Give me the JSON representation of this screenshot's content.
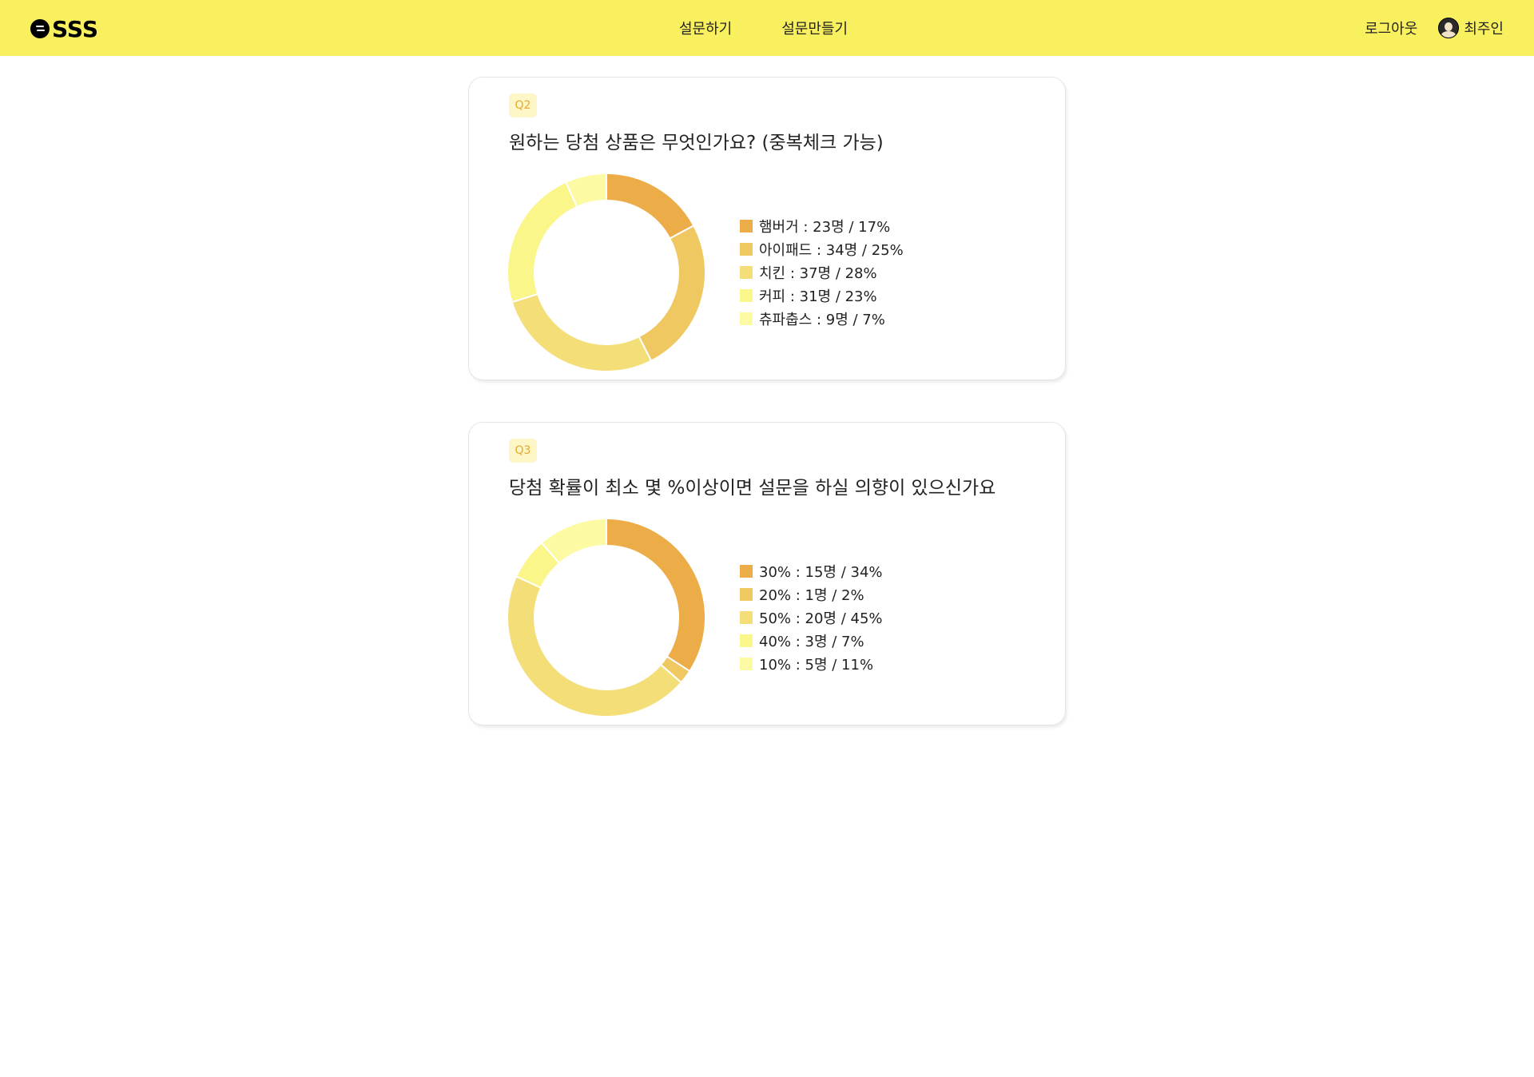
{
  "brand": {
    "name": "SSS"
  },
  "nav": {
    "items": [
      "설문하기",
      "설문만들기"
    ]
  },
  "user": {
    "logout_label": "로그아웃",
    "name": "최주인"
  },
  "colors": {
    "topbar": "#f8f05f",
    "badge_bg": "#fdf6c6",
    "badge_text": "#e6a830",
    "slices": [
      "#ecac48",
      "#f0c862",
      "#f4de78",
      "#faf68a",
      "#fdfaa4"
    ]
  },
  "questions": [
    {
      "badge": "Q2",
      "title": "원하는 당첨 상품은 무엇인가요? (중복체크 가능)",
      "legend": [
        "햄버거 : 23명 / 17%",
        "아이패드 : 34명 / 25%",
        "치킨 : 37명 / 28%",
        "커피 : 31명 / 23%",
        "츄파춥스 : 9명 / 7%"
      ]
    },
    {
      "badge": "Q3",
      "title": "당첨 확률이 최소 몇 %이상이면 설문을 하실 의향이 있으신가요",
      "legend": [
        "30% : 15명 / 34%",
        "20% : 1명 / 2%",
        "50% : 20명 / 45%",
        "40% : 3명 / 7%",
        "10% : 5명 / 11%"
      ]
    }
  ],
  "chart_data": [
    {
      "type": "pie",
      "title": "원하는 당첨 상품은 무엇인가요? (중복체크 가능)",
      "categories": [
        "햄버거",
        "아이패드",
        "치킨",
        "커피",
        "츄파춥스"
      ],
      "values": [
        23,
        34,
        37,
        31,
        9
      ],
      "percentages": [
        17,
        25,
        28,
        23,
        7
      ],
      "legend_position": "right"
    },
    {
      "type": "pie",
      "title": "당첨 확률이 최소 몇 %이상이면 설문을 하실 의향이 있으신가요",
      "categories": [
        "30%",
        "20%",
        "50%",
        "40%",
        "10%"
      ],
      "values": [
        15,
        1,
        20,
        3,
        5
      ],
      "percentages": [
        34,
        2,
        45,
        7,
        11
      ],
      "legend_position": "right"
    }
  ]
}
